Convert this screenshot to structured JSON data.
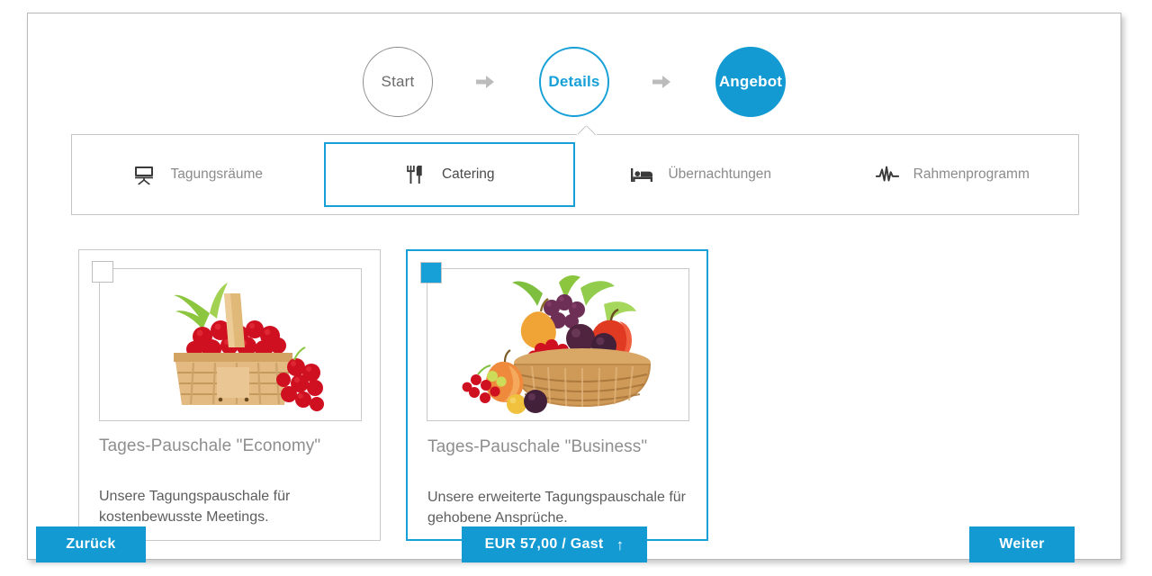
{
  "stepper": {
    "steps": [
      {
        "label": "Start",
        "state": "done"
      },
      {
        "label": "Details",
        "state": "current"
      },
      {
        "label": "Angebot",
        "state": "future"
      }
    ],
    "separator_icon": "arrow-right-icon"
  },
  "tabs": [
    {
      "label": "Tagungsräume",
      "icon": "projector-screen-icon",
      "active": false
    },
    {
      "label": "Catering",
      "icon": "fork-knife-icon",
      "active": true
    },
    {
      "label": "Übernachtungen",
      "icon": "bed-icon",
      "active": false
    },
    {
      "label": "Rahmenprogramm",
      "icon": "pulse-activity-icon",
      "active": false
    }
  ],
  "cards": [
    {
      "title": "Tages-Pauschale \"Economy\"",
      "description": "Unsere Tagungspauschale für kostenbewusste Meetings.",
      "image": "red-currant-basket",
      "selected": false,
      "checkbox_state": "unchecked"
    },
    {
      "title": "Tages-Pauschale \"Business\"",
      "description": "Unsere erweiterte Tagungspauschale für gehobene Ansprüche.",
      "image": "mixed-fruit-basket",
      "selected": true,
      "checkbox_state": "checked"
    }
  ],
  "footer": {
    "back_label": "Zurück",
    "price_label": "EUR 57,00 / Gast",
    "price_arrow": "↑",
    "next_label": "Weiter"
  },
  "colors": {
    "accent": "#139ad3",
    "accent_border": "#17a0d8",
    "text_muted": "#8b8b8b",
    "text_body": "#5d5d5d",
    "frame_border": "#b9b9b9"
  }
}
